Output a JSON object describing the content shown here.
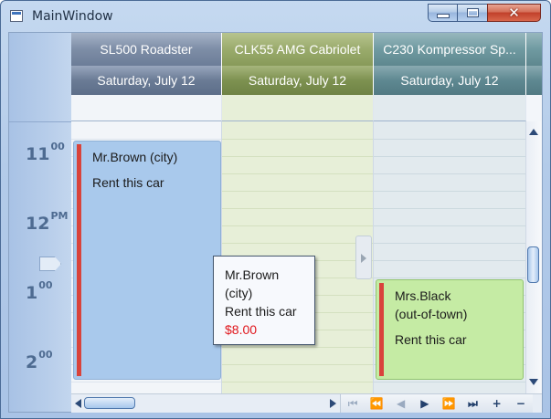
{
  "window": {
    "title": "MainWindow"
  },
  "resources": [
    {
      "name": "SL500 Roadster",
      "date": "Saturday, July 12",
      "hdr_color": "#7d8da6",
      "hdr2_color": "#6a7b95",
      "body_color": "#f2f5f9",
      "slot_color": "#dde5ee"
    },
    {
      "name": "CLK55 AMG Cabriolet",
      "date": "Saturday, July 12",
      "hdr_color": "#9aab6c",
      "hdr2_color": "#7d9150",
      "body_color": "#e7efd8",
      "slot_color": "#d4e0c0"
    },
    {
      "name": "C230 Kompressor Sp...",
      "date": "Saturday, July 12",
      "hdr_color": "#6f9aa1",
      "hdr2_color": "#5e8891",
      "body_color": "#e2eaee",
      "slot_color": "#ccd9df"
    }
  ],
  "time_ruler": {
    "hours": [
      {
        "hour": "11",
        "suffix": "00"
      },
      {
        "hour": "12",
        "suffix": "PM"
      },
      {
        "hour": "1",
        "suffix": "00"
      },
      {
        "hour": "2",
        "suffix": "00"
      }
    ]
  },
  "appointments": [
    {
      "subject": "Mr.Brown (city)",
      "body": "Rent this car",
      "color": "#a9c9ec"
    },
    {
      "subject_line1": "Mrs.Black",
      "subject_line2": "(out-of-town)",
      "body": "Rent this car",
      "color": "#c5eba4"
    }
  ],
  "tooltip": {
    "line1": "Mr.Brown",
    "line2": "(city)",
    "line3": "Rent this car",
    "price": "$8.00"
  },
  "navigation": {
    "buttons": [
      "⏮",
      "⏪",
      "◀",
      "▶",
      "⏩",
      "⏭",
      "+",
      "−"
    ]
  }
}
